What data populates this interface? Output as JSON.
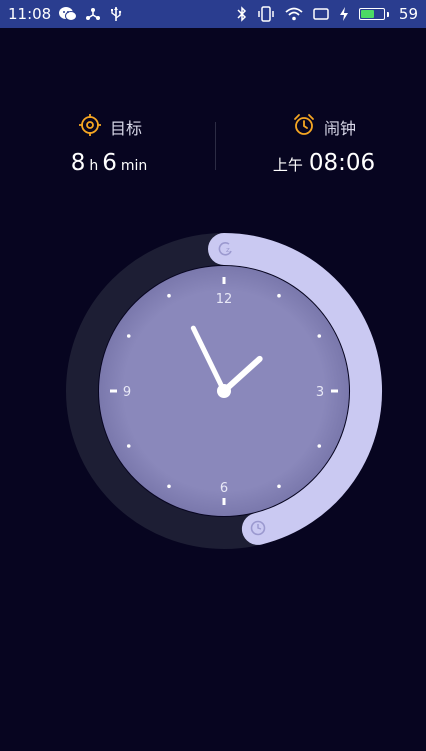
{
  "status_bar": {
    "time": "11:08",
    "battery_percent": "59",
    "battery_level": 0.59,
    "icons": [
      "wechat-icon",
      "usb-share-icon",
      "usb-icon",
      "bluetooth-icon",
      "vibrate-icon",
      "wifi-icon",
      "screen-icon",
      "charging-icon",
      "battery-icon"
    ]
  },
  "goal": {
    "label": "目标",
    "icon": "target-icon",
    "hours": "8",
    "hours_unit": "h",
    "minutes": "6",
    "minutes_unit": "min"
  },
  "alarm": {
    "label": "闹钟",
    "icon": "alarm-clock-icon",
    "period": "上午",
    "time": "08:06"
  },
  "clock_dial": {
    "numerals": [
      "12",
      "3",
      "6",
      "9"
    ],
    "hour_hand_time": "11:08",
    "sleep_start_icon": "sleep-moon-icon",
    "wake_icon": "wake-clock-icon"
  },
  "colors": {
    "background": "#070520",
    "status_bar": "#2a3d8f",
    "accent_orange": "#f5a623",
    "ring_track": "#1d1e34",
    "ring_active": "#cac9f2",
    "dial_face": "#8a88bb"
  }
}
